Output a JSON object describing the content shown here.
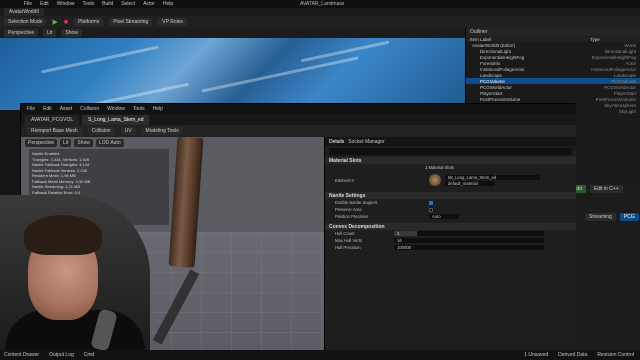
{
  "app": {
    "title": "AVATAR_Landmass",
    "menu": [
      "File",
      "Edit",
      "Window",
      "Tools",
      "Build",
      "Select",
      "Actor",
      "Help"
    ],
    "level_tab": "AvatarWorld0",
    "toolbar": {
      "mode": "Selection Mode",
      "platforms": "Platforms",
      "pixel_streaming": "Pixel Streaming",
      "vp_roles": "VP Roles"
    },
    "viewport": {
      "perspective": "Perspective",
      "lit": "Lit",
      "show": "Show"
    }
  },
  "outliner": {
    "title": "Outliner",
    "col_item": "Item Label",
    "col_type": "Type",
    "items": [
      {
        "label": "AvatarWorld0 (Editor)",
        "type": "World"
      },
      {
        "label": "DirectionalLight",
        "type": "DirectionalLight"
      },
      {
        "label": "ExponentialHeightFog",
        "type": "ExponentialHeightFog"
      },
      {
        "label": "ForestInfo",
        "type": "Actor"
      },
      {
        "label": "InstancedFoliageActor",
        "type": "InstancedFoliageActor"
      },
      {
        "label": "Landscape",
        "type": "Landscape"
      },
      {
        "label": "PCGVolume",
        "type": "PCGVolume",
        "selected": true
      },
      {
        "label": "PCGWorldActor",
        "type": "PCGWorldActor"
      },
      {
        "label": "PlayerStart",
        "type": "PlayerStart"
      },
      {
        "label": "PostProcessVolume",
        "type": "PostProcessVolume"
      },
      {
        "label": "SkyAtmosphere",
        "type": "SkyAtmosphere"
      },
      {
        "label": "SkyLight",
        "type": "SkyLight"
      }
    ]
  },
  "mesh_editor": {
    "tabs": [
      "AVATAR_PCGVOL",
      "S_Long_Lama_Stem_ed"
    ],
    "menu": [
      "File",
      "Edit",
      "Asset",
      "Collision",
      "Window",
      "Tools",
      "Help"
    ],
    "toolbar": [
      "Reimport Base Mesh",
      "Collision",
      "UV",
      "Modeling Tools"
    ],
    "viewport": {
      "perspective": "Perspective",
      "lit": "Lit",
      "show": "Show",
      "lod": "LOD Auto"
    },
    "stats": [
      "Nanite Enabled",
      "Triangles: 3,034,  Vertices: 1,526",
      "Nanite Fallback Triangles: 4,144",
      "Nanite Fallback Vertices: 2,245",
      "Resident Mesh: 1,96 MB",
      "Fallback Mesh Memory: 3,30 MB",
      "Nanite Streaming: 1,21 MB",
      "Fallback Relative Error: 0,0",
      "Fallback Triangles: 2,034",
      "Fallback Vertices: 1,045",
      "Approx Size: 17x17x1100",
      "Num Collision Primitives: 1",
      "Distance Field: 64x64x128"
    ]
  },
  "details": {
    "tabs": [
      "Details",
      "Socket Manager"
    ],
    "sections": {
      "material_slots": "Material Slots",
      "nanite": "Nanite Settings",
      "convex": "Convex Decomposition"
    },
    "material_slots_count": "1 Material Slots",
    "element": "Element 0",
    "material_name": "MI_Long_Lama_Stem_ed",
    "slot_name": "default_material",
    "nanite": {
      "enable": "Enable Nanite Support",
      "preserve": "Preserve Area",
      "position_precision": "Position Precision",
      "position_value": "Auto"
    },
    "convex": {
      "hull_count": "Hull Count",
      "hull_value": "4",
      "max_hull_verts": "Max Hull Verts",
      "max_hull_value": "16",
      "hull_precision": "Hull Precision",
      "hull_precision_value": "100000",
      "fill_fraction": 0.15
    },
    "apply": "Apply"
  },
  "right_panel": {
    "add": "+ Add",
    "edit_cpp": "Edit in C++",
    "streaming": "Streaming",
    "pcg": "PCG",
    "unsaved": "1 Unsaved",
    "revision": "Revision Control",
    "settings": "Settings"
  },
  "trees": {
    "title": "Trees",
    "settings": "Settings"
  },
  "bottom": {
    "content_drawer": "Content Drawer",
    "output_log": "Output Log",
    "cmd": "Cmd",
    "unsaved": "1 Unsaved",
    "derived": "Derived Data",
    "revision": "Revision Control"
  },
  "colors": {
    "accent": "#0f4d8a",
    "play": "#3fbf3f",
    "stop": "#dd3344"
  }
}
